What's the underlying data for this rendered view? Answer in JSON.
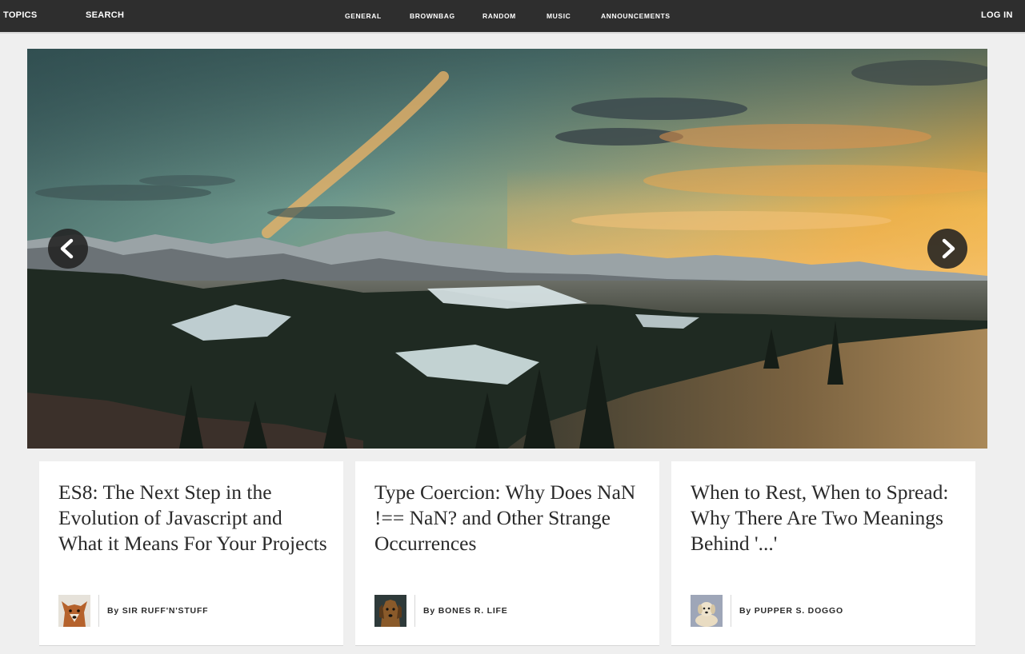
{
  "nav": {
    "left": [
      "TOPICS",
      "SEARCH"
    ],
    "center": [
      "GENERAL",
      "BROWNBAG",
      "RANDOM",
      "MUSIC",
      "ANNOUNCEMENTS"
    ],
    "right": "LOG IN"
  },
  "hero": {
    "prev_icon": "chevron-left-icon",
    "next_icon": "chevron-right-icon"
  },
  "articles": [
    {
      "title": "ES8: The Next Step in the Evolution of Javascript and What it Means For Your Projects",
      "by_prefix": "By",
      "author": "SIR RUFF'N'STUFF"
    },
    {
      "title": "Type Coercion: Why Does NaN !== NaN? and Other Strange Occurrences",
      "by_prefix": "By",
      "author": "BONES R. LIFE"
    },
    {
      "title": "When to Rest, When to Spread: Why There Are Two Meanings Behind '...'",
      "by_prefix": "By",
      "author": "PUPPER S. DOGGO"
    }
  ],
  "colors": {
    "nav_bg": "#2e2e2e",
    "page_bg": "#efefef",
    "card_bg": "#ffffff",
    "text": "#2a2a2a"
  }
}
